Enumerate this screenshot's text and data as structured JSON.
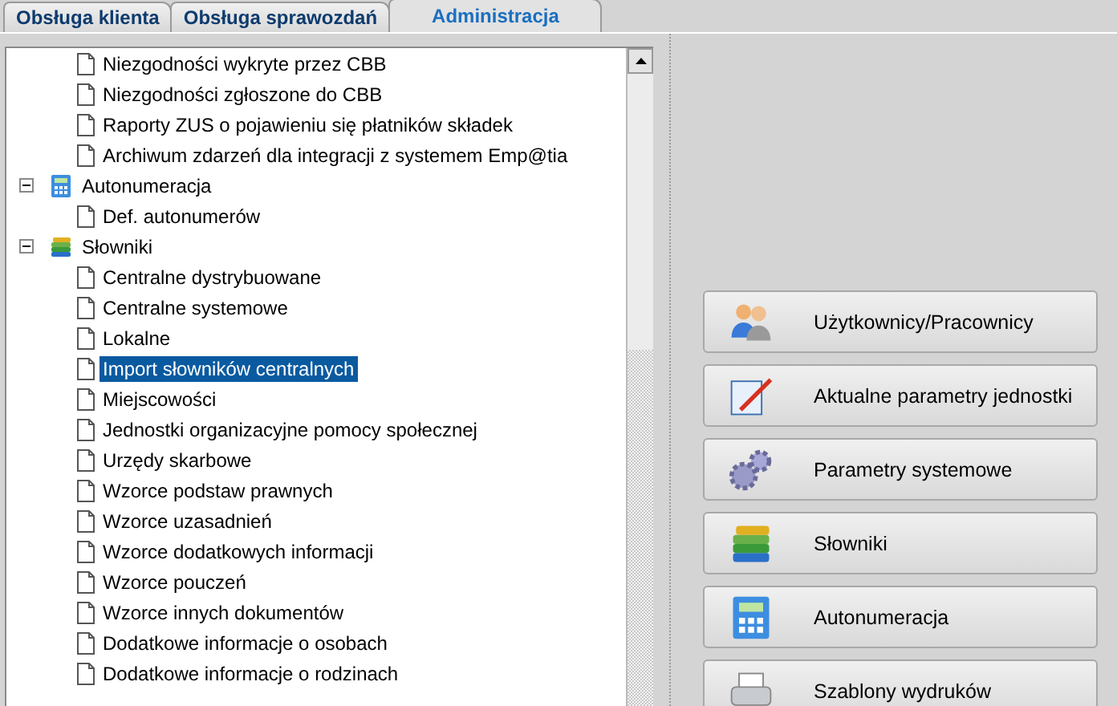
{
  "tabs": [
    {
      "label": "Obsługa klienta",
      "selected": false
    },
    {
      "label": "Obsługa sprawozdań",
      "selected": false
    },
    {
      "label": "Administracja",
      "selected": true
    }
  ],
  "tree": [
    {
      "children": [
        {
          "label": "Niezgodności wykryte przez CBB",
          "selected": false
        },
        {
          "label": "Niezgodności zgłoszone do CBB",
          "selected": false
        },
        {
          "label": "Raporty ZUS o pojawieniu się płatników składek",
          "selected": false
        },
        {
          "label": "Archiwum zdarzeń dla integracji z systemem Emp@tia",
          "selected": false
        }
      ]
    },
    {
      "label": "Autonumeracja",
      "kind": "calculator",
      "expanded": true,
      "selected": false,
      "children": [
        {
          "label": "Def. autonumerów",
          "selected": false
        }
      ]
    },
    {
      "label": "Słowniki",
      "kind": "books",
      "expanded": true,
      "selected": false,
      "children": [
        {
          "label": "Centralne dystrybuowane",
          "selected": false
        },
        {
          "label": "Centralne systemowe",
          "selected": false
        },
        {
          "label": "Lokalne",
          "selected": false
        },
        {
          "label": "Import słowników centralnych",
          "selected": true
        },
        {
          "label": "Miejscowości",
          "selected": false
        },
        {
          "label": "Jednostki organizacyjne pomocy społecznej",
          "selected": false
        },
        {
          "label": "Urzędy skarbowe",
          "selected": false
        },
        {
          "label": "Wzorce podstaw prawnych",
          "selected": false
        },
        {
          "label": "Wzorce uzasadnień",
          "selected": false
        },
        {
          "label": "Wzorce dodatkowych informacji",
          "selected": false
        },
        {
          "label": "Wzorce pouczeń",
          "selected": false
        },
        {
          "label": "Wzorce innych dokumentów",
          "selected": false
        },
        {
          "label": "Dodatkowe informacje o osobach",
          "selected": false
        },
        {
          "label": "Dodatkowe informacje o rodzinach",
          "selected": false
        }
      ]
    }
  ],
  "buttons": [
    {
      "label": "Użytkownicy/Pracownicy",
      "kind": "users"
    },
    {
      "label": "Aktualne parametry jednostki",
      "kind": "pen"
    },
    {
      "label": "Parametry systemowe",
      "kind": "gears"
    },
    {
      "label": "Słowniki",
      "kind": "books"
    },
    {
      "label": "Autonumeracja",
      "kind": "calculator"
    },
    {
      "label": "Szablony wydruków",
      "kind": "printer"
    }
  ]
}
